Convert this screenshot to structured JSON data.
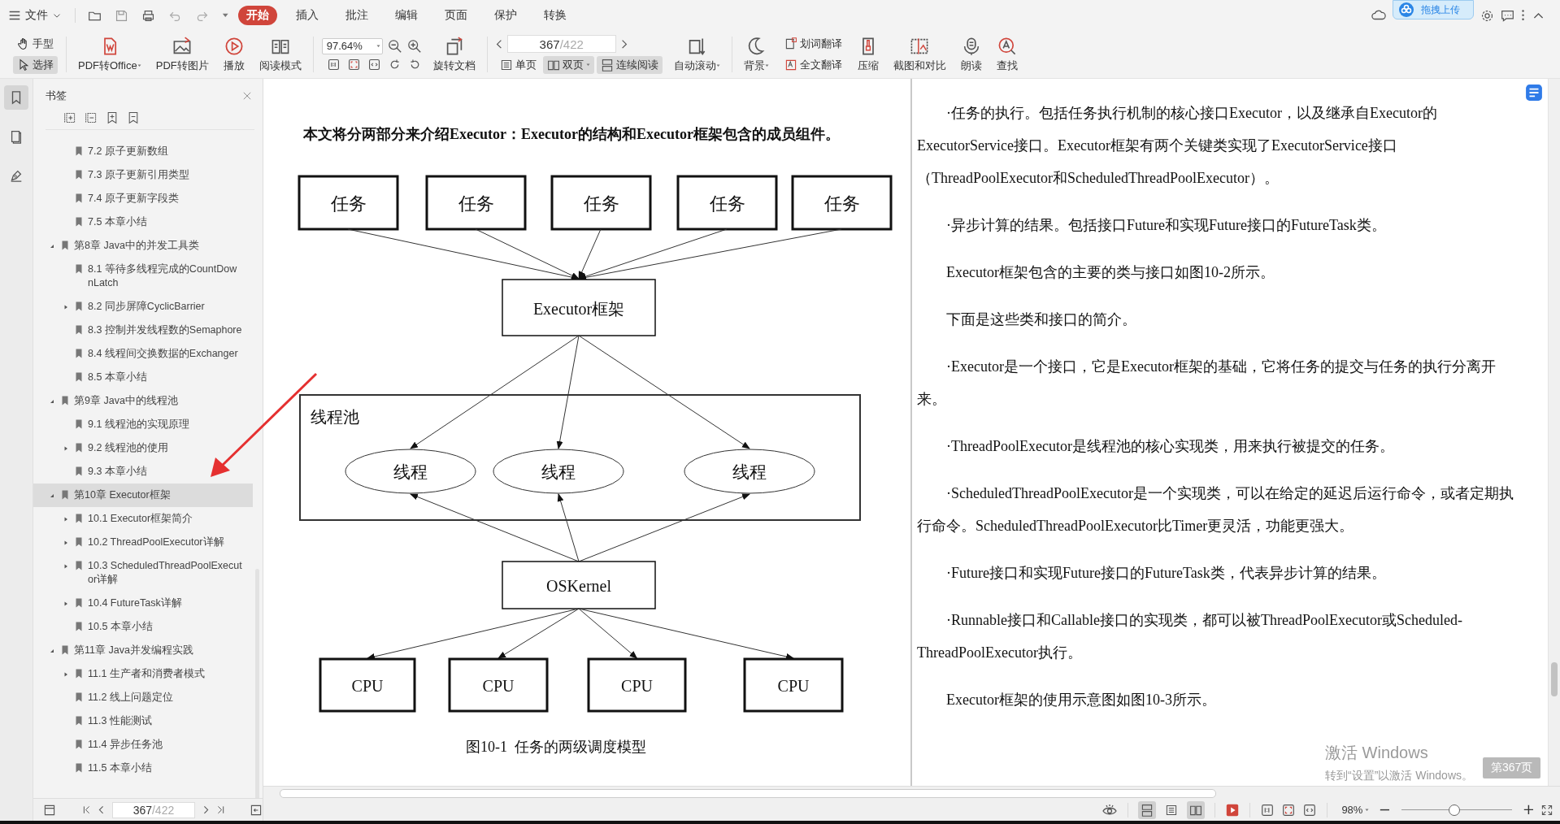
{
  "menu": {
    "file": "文件",
    "tabs": [
      {
        "label": "开始",
        "selected": true
      },
      {
        "label": "插入",
        "selected": false
      },
      {
        "label": "批注",
        "selected": false
      },
      {
        "label": "编辑",
        "selected": false
      },
      {
        "label": "页面",
        "selected": false
      },
      {
        "label": "保护",
        "selected": false
      },
      {
        "label": "转换",
        "selected": false
      }
    ],
    "upload_popup": "拖拽上传"
  },
  "toolbar": {
    "hand": {
      "label": "手型",
      "selected": false
    },
    "select": {
      "label": "选择",
      "selected": true
    },
    "pdf_to_office": "PDF转Office",
    "pdf_to_image": "PDF转图片",
    "play": "播放",
    "reading_mode": "阅读模式",
    "zoom": "97.64%",
    "rotate": "旋转文档",
    "page_current": "367",
    "page_total": "/422",
    "single": {
      "label": "单页",
      "selected": false
    },
    "double": {
      "label": "双页",
      "selected": true
    },
    "continuous": {
      "label": "连续阅读",
      "selected": true
    },
    "auto_scroll": "自动滚动",
    "background": "背景",
    "word_translate": "划词翻译",
    "full_translate": "全文翻译",
    "compress": "压缩",
    "screenshot_compare": "截图和对比",
    "read_aloud": "朗读",
    "find": "查找"
  },
  "sidebar": {
    "title": "书签",
    "bookmarks": [
      {
        "children": [
          {
            "label": "7.2 原子更新数组",
            "selected": false
          },
          {
            "label": "7.3 原子更新引用类型",
            "selected": false
          },
          {
            "label": "7.4 原子更新字段类",
            "selected": false
          },
          {
            "label": "7.5 本章小结",
            "selected": false
          }
        ]
      },
      {
        "label": "第8章 Java中的并发工具类",
        "selected": false,
        "expanded": true,
        "children": [
          {
            "label": "8.1 等待多线程完成的CountDownLatch",
            "selected": false
          },
          {
            "label": "8.2 同步屏障CyclicBarrier",
            "selected": false,
            "expanded": false
          },
          {
            "label": "8.3 控制并发线程数的Semaphore",
            "selected": false
          },
          {
            "label": "8.4 线程间交换数据的Exchanger",
            "selected": false
          },
          {
            "label": "8.5 本章小结",
            "selected": false
          }
        ]
      },
      {
        "label": "第9章 Java中的线程池",
        "selected": false,
        "expanded": true,
        "children": [
          {
            "label": "9.1 线程池的实现原理",
            "selected": false
          },
          {
            "label": "9.2 线程池的使用",
            "selected": false,
            "expanded": false
          },
          {
            "label": "9.3 本章小结",
            "selected": false
          }
        ]
      },
      {
        "label": "第10章 Executor框架",
        "selected": true,
        "expanded": true,
        "children": [
          {
            "label": "10.1 Executor框架简介",
            "selected": false,
            "expanded": false
          },
          {
            "label": "10.2 ThreadPoolExecutor详解",
            "selected": false,
            "expanded": false
          },
          {
            "label": "10.3 ScheduledThreadPoolExecutor详解",
            "selected": false,
            "expanded": false
          },
          {
            "label": "10.4 FutureTask详解",
            "selected": false,
            "expanded": false
          },
          {
            "label": "10.5 本章小结",
            "selected": false
          }
        ]
      },
      {
        "label": "第11章 Java并发编程实践",
        "selected": false,
        "expanded": true,
        "children": [
          {
            "label": "11.1 生产者和消费者模式",
            "selected": false,
            "expanded": false
          },
          {
            "label": "11.2 线上问题定位",
            "selected": false
          },
          {
            "label": "11.3 性能测试",
            "selected": false
          },
          {
            "label": "11.4 异步任务池",
            "selected": false
          },
          {
            "label": "11.5 本章小结",
            "selected": false
          }
        ]
      }
    ],
    "page_current": "367",
    "page_total": "/422"
  },
  "left_page": {
    "intro": "本文将分两部分来介绍Executor：Executor的结构和Executor框架包含的成员组件。",
    "diagram": {
      "tasks": [
        "任务",
        "任务",
        "任务",
        "任务",
        "任务"
      ],
      "framework": "Executor框架",
      "pool": "线程池",
      "threads": [
        "线程",
        "线程",
        "线程"
      ],
      "kernel": "OSKernel",
      "cpus": [
        "CPU",
        "CPU",
        "CPU",
        "CPU"
      ],
      "caption": "图10-1  任务的两级调度模型"
    }
  },
  "right_page": {
    "paragraphs": [
      "·任务的执行。包括任务执行机制的核心接口Executor，以及继承自Executor的ExecutorService接口。Executor框架有两个关键类实现了ExecutorService接口（ThreadPoolExecutor和ScheduledThreadPoolExecutor）。",
      "·异步计算的结果。包括接口Future和实现Future接口的FutureTask类。",
      "Executor框架包含的主要的类与接口如图10-2所示。",
      "下面是这些类和接口的简介。",
      "·Executor是一个接口，它是Executor框架的基础，它将任务的提交与任务的执行分离开来。",
      "·ThreadPoolExecutor是线程池的核心实现类，用来执行被提交的任务。",
      "·ScheduledThreadPoolExecutor是一个实现类，可以在给定的延迟后运行命令，或者定期执行命令。ScheduledThreadPoolExecutor比Timer更灵活，功能更强大。",
      "·Future接口和实现Future接口的FutureTask类，代表异步计算的结果。",
      "·Runnable接口和Callable接口的实现类，都可以被ThreadPoolExecutor或Scheduled-ThreadPoolExecutor执行。",
      "Executor框架的使用示意图如图10-3所示。"
    ]
  },
  "windows_notice": {
    "title": "激活 Windows",
    "hint": "转到“设置”以激活 Windows。"
  },
  "page_badge": "第367页",
  "status_bar": {
    "view_modes": [
      {
        "selected": true
      },
      {
        "selected": false
      },
      {
        "selected": true
      }
    ],
    "zoom": "98%",
    "level": 0.48
  }
}
